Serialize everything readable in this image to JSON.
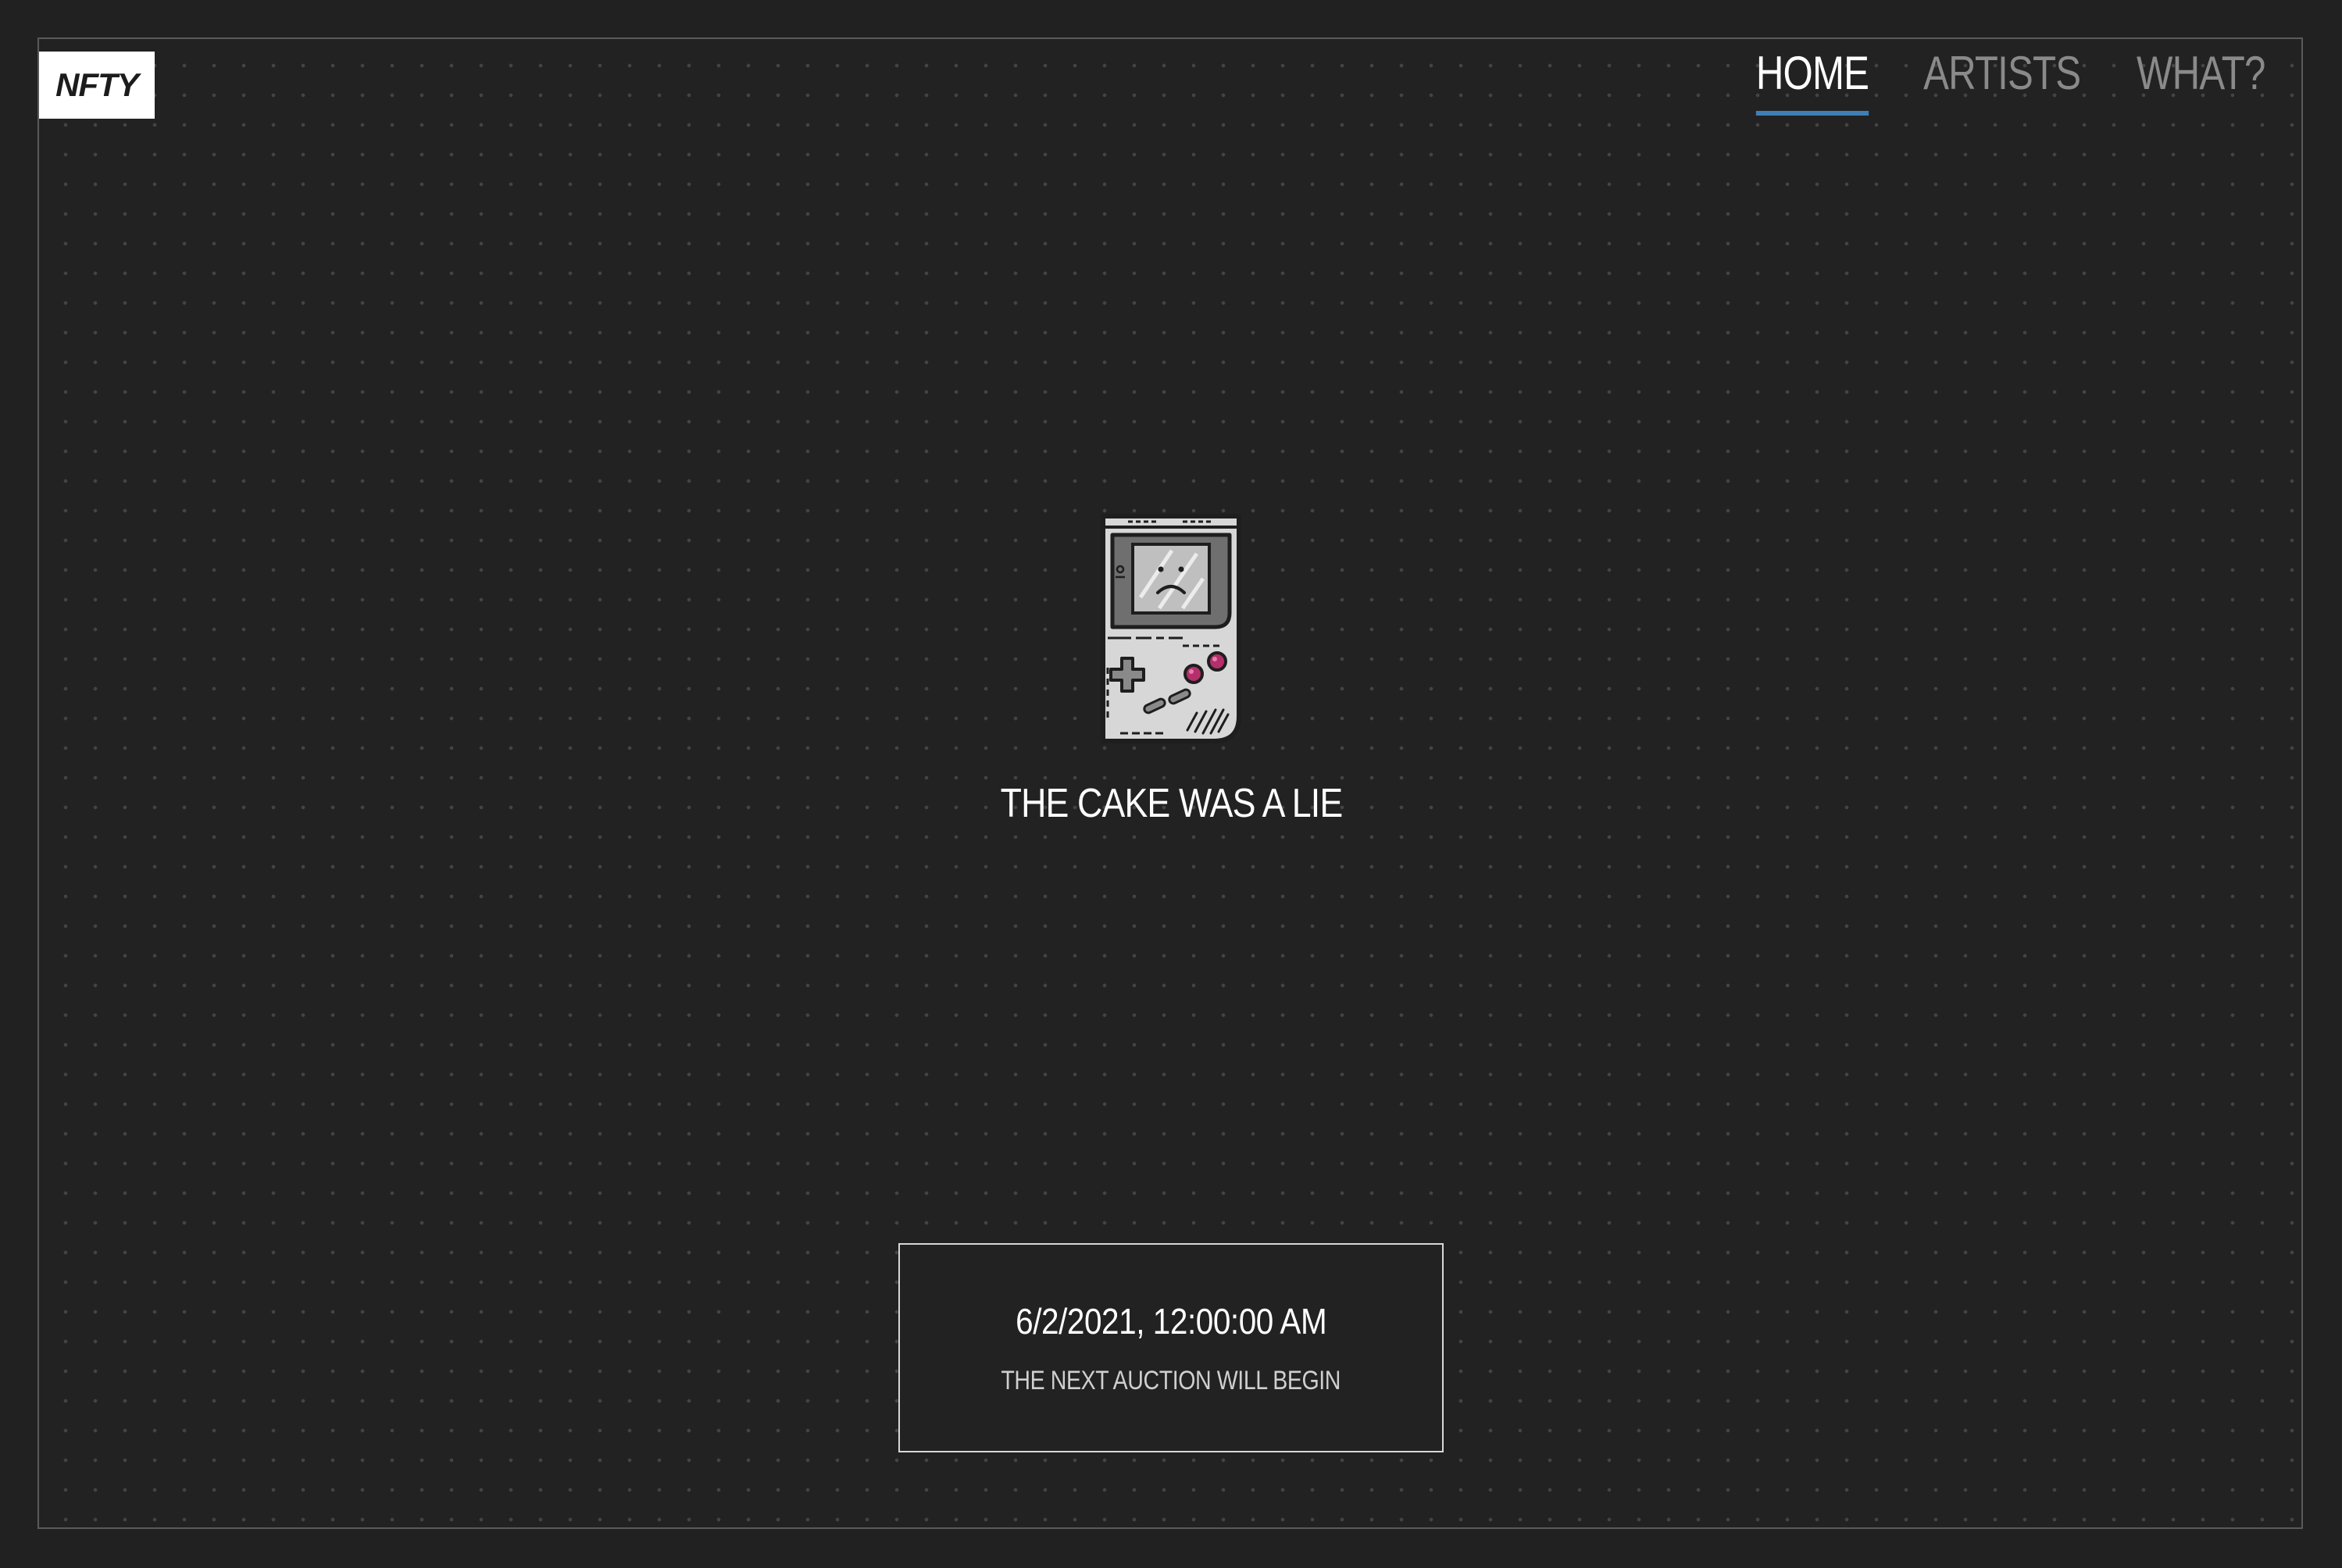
{
  "brand": {
    "logo_text": "NFTY"
  },
  "nav": {
    "items": [
      {
        "label": "HOME",
        "active": true
      },
      {
        "label": "ARTISTS",
        "active": false
      },
      {
        "label": "WHAT?",
        "active": false
      }
    ]
  },
  "hero": {
    "icon": "gameboy-sad-icon",
    "caption": "THE CAKE WAS A LIE"
  },
  "auction": {
    "datetime": "6/2/2021, 12:00:00 AM",
    "label": "THE NEXT AUCTION WILL BEGIN"
  },
  "colors": {
    "background": "#212121",
    "accent": "#3f7fb5",
    "gameboy_buttons": "#b5306b"
  }
}
